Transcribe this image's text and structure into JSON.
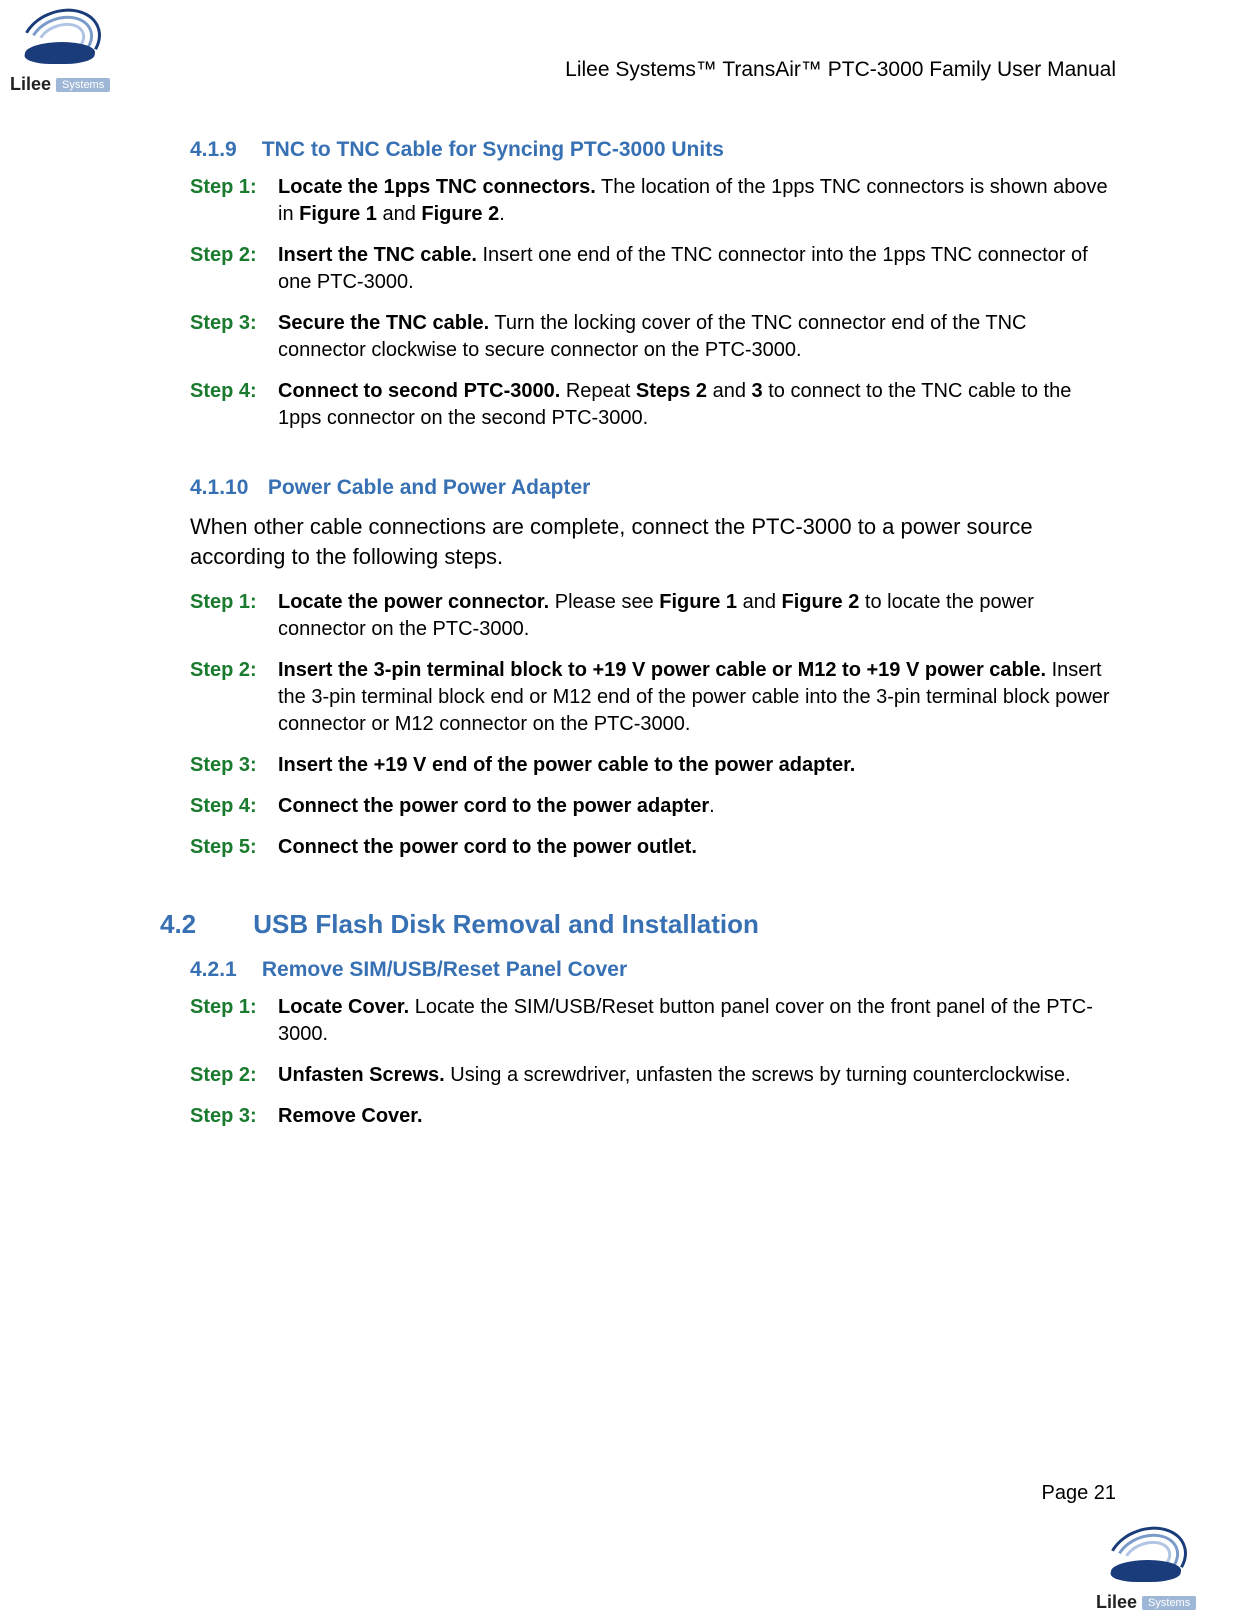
{
  "header": {
    "doc_title": "Lilee Systems™ TransAir™ PTC-3000 Family User Manual"
  },
  "logo": {
    "brand": "Lilee",
    "tag": "Systems"
  },
  "sections": {
    "s419": {
      "num": "4.1.9",
      "title": "TNC to TNC Cable for Syncing PTC-3000 Units",
      "steps": [
        {
          "label": "Step 1:",
          "bold": "Locate the 1pps TNC connectors.",
          "rest": " The location of the 1pps TNC connectors is shown above in ",
          "bold2": "Figure 1",
          "mid": " and ",
          "bold3": "Figure 2",
          "tail": "."
        },
        {
          "label": "Step 2:",
          "bold": "Insert the TNC cable.",
          "rest": " Insert one end of the TNC connector into the 1pps TNC connector of one PTC-3000."
        },
        {
          "label": "Step 3:",
          "bold": "Secure the TNC cable.",
          "rest": " Turn the locking cover of the TNC connector end of the TNC connector clockwise to secure connector on the PTC-3000."
        },
        {
          "label": "Step 4:",
          "bold": "Connect to second PTC-3000.",
          "rest": " Repeat ",
          "bold2": "Steps 2",
          "mid": " and ",
          "bold3": "3",
          "tail": " to connect to the TNC cable to the 1pps connector on the second PTC-3000."
        }
      ]
    },
    "s4110": {
      "num": "4.1.10",
      "title": "Power Cable and Power Adapter",
      "intro": "When other cable connections are complete, connect the PTC-3000 to a power source according to the following steps.",
      "steps": [
        {
          "label": "Step 1:",
          "bold": "Locate the power connector.",
          "rest": " Please see ",
          "bold2": "Figure 1",
          "mid": " and ",
          "bold3": "Figure 2",
          "tail": " to locate the power connector on the PTC-3000."
        },
        {
          "label": "Step 2:",
          "bold": "Insert the 3-pin terminal block to +19 V power cable or M12 to +19 V power cable.",
          "rest": " Insert the 3-pin terminal block end or M12 end of the power cable into the 3-pin terminal block power connector or M12 connector on the PTC-3000."
        },
        {
          "label": "Step 3:",
          "bold": "Insert the +19 V end of the power cable to the power adapter.",
          "rest": ""
        },
        {
          "label": "Step 4:",
          "bold": "Connect the power cord to the power adapter",
          "rest": "."
        },
        {
          "label": "Step 5:",
          "bold": "Connect the power cord to the power outlet.",
          "rest": ""
        }
      ]
    },
    "s42": {
      "num": "4.2",
      "title": "USB Flash Disk Removal and Installation"
    },
    "s421": {
      "num": "4.2.1",
      "title": "Remove SIM/USB/Reset Panel Cover",
      "steps": [
        {
          "label": "Step 1:",
          "bold": "Locate Cover.",
          "rest": " Locate the SIM/USB/Reset button panel cover on the front panel of the PTC-3000."
        },
        {
          "label": "Step 2:",
          "bold": "Unfasten Screws.",
          "rest": " Using a screwdriver, unfasten the screws by turning counterclockwise."
        },
        {
          "label": "Step 3:",
          "bold": "Remove Cover.",
          "rest": ""
        }
      ]
    }
  },
  "footer": {
    "page": "Page 21"
  }
}
